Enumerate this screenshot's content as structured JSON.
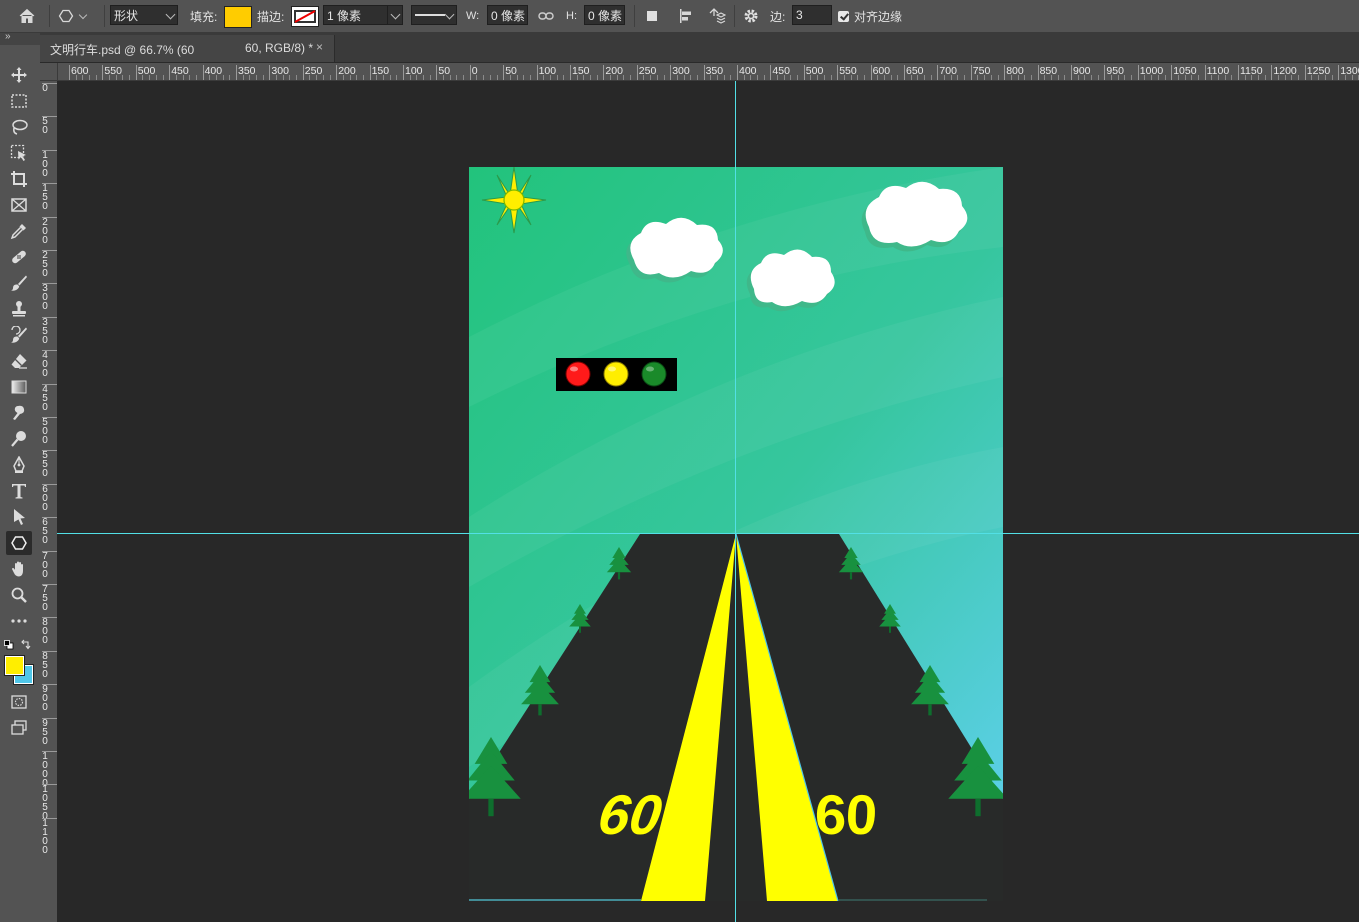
{
  "options_bar": {
    "mode_label": "形状",
    "fill_label": "填充:",
    "fill_color": "#ffcc00",
    "stroke_label": "描边:",
    "stroke_width": "1 像素",
    "w_label": "W:",
    "w_value": "0 像素",
    "h_label": "H:",
    "h_value": "0 像素",
    "sides_label": "边:",
    "sides_value": "3",
    "align_edges_label": "对齐边缘",
    "align_edges_checked": true
  },
  "document_tab": {
    "title": "文明行车.psd @ 66.7% (60",
    "title_suffix": "60, RGB/8) *",
    "close_label": "×"
  },
  "rulers": {
    "horizontal_labels": [
      "600",
      "550",
      "500",
      "450",
      "400",
      "350",
      "300",
      "250",
      "200",
      "150",
      "100",
      "50",
      "0",
      "50",
      "100",
      "150",
      "200",
      "250",
      "300",
      "350",
      "400",
      "450",
      "500",
      "550",
      "600",
      "650",
      "700",
      "750",
      "800",
      "850",
      "900",
      "950",
      "1000",
      "1050",
      "1100",
      "1150",
      "1200",
      "1250",
      "1300"
    ],
    "vertical_labels": [
      "0",
      "50",
      "100",
      "150",
      "200",
      "250",
      "300",
      "350",
      "400",
      "450",
      "500",
      "550",
      "600",
      "650",
      "700",
      "750",
      "800",
      "850",
      "900",
      "950",
      "1000",
      "1050",
      "1100"
    ]
  },
  "tools": [
    {
      "name": "move-tool",
      "icon": "move-icon"
    },
    {
      "name": "marquee-tool",
      "icon": "marquee-icon"
    },
    {
      "name": "lasso-tool",
      "icon": "lasso-icon"
    },
    {
      "name": "object-select-tool",
      "icon": "object-select-icon"
    },
    {
      "name": "crop-tool",
      "icon": "crop-icon"
    },
    {
      "name": "frame-tool",
      "icon": "frame-icon"
    },
    {
      "name": "eyedropper-tool",
      "icon": "eyedropper-icon"
    },
    {
      "name": "healing-tool",
      "icon": "bandage-icon"
    },
    {
      "name": "brush-tool",
      "icon": "brush-icon"
    },
    {
      "name": "stamp-tool",
      "icon": "stamp-icon"
    },
    {
      "name": "history-brush-tool",
      "icon": "history-brush-icon"
    },
    {
      "name": "eraser-tool",
      "icon": "eraser-icon"
    },
    {
      "name": "gradient-tool",
      "icon": "gradient-icon"
    },
    {
      "name": "smudge-tool",
      "icon": "smudge-icon"
    },
    {
      "name": "dodge-tool",
      "icon": "dodge-icon"
    },
    {
      "name": "pen-tool",
      "icon": "pen-icon"
    },
    {
      "name": "type-tool",
      "icon": "type-icon"
    },
    {
      "name": "path-select-tool",
      "icon": "path-select-icon"
    },
    {
      "name": "polygon-tool",
      "icon": "polygon-icon",
      "active": true
    },
    {
      "name": "hand-tool",
      "icon": "hand-icon"
    },
    {
      "name": "zoom-tool",
      "icon": "zoom-icon"
    },
    {
      "name": "more-tools",
      "icon": "ellipsis-icon"
    }
  ],
  "colors": {
    "foreground": "#ffee00",
    "background": "#4fc6e8",
    "guide": "#52e0e6"
  },
  "artwork": {
    "speed_left": "60",
    "speed_right": "60",
    "traffic_lights": [
      "#ff1a1a",
      "#ffee00",
      "#1a8a2a"
    ]
  }
}
